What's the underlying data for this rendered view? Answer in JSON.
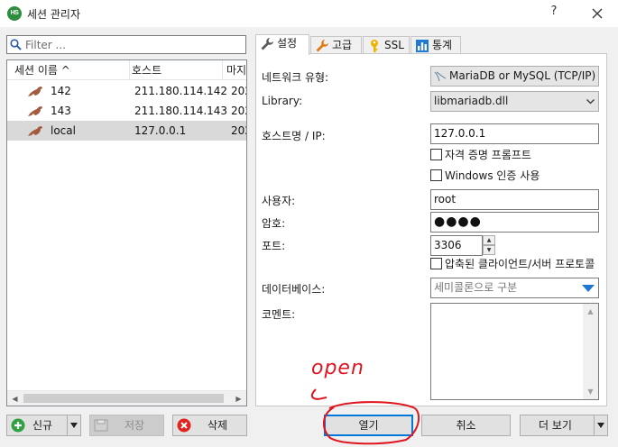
{
  "window": {
    "title": "세션 관리자",
    "icon_text": "HS",
    "help_label": "?",
    "close_label": "X"
  },
  "filter": {
    "placeholder": "Filter ..."
  },
  "session_list": {
    "columns": [
      "세션 이름 ^",
      "호스트",
      "마지"
    ],
    "rows": [
      {
        "name": "142",
        "host": "211.180.114.142",
        "extra": "202",
        "selected": false
      },
      {
        "name": "143",
        "host": "211.180.114.143",
        "extra": "202",
        "selected": false
      },
      {
        "name": "local",
        "host": "127.0.0.1",
        "extra": "202",
        "selected": true
      }
    ]
  },
  "tabs": [
    {
      "label": "설정",
      "icon": "wrench-icon",
      "active": true
    },
    {
      "label": "고급",
      "icon": "wrench-orange-icon",
      "active": false
    },
    {
      "label": "SSL",
      "icon": "key-icon",
      "active": false
    },
    {
      "label": "통계",
      "icon": "bar-chart-icon",
      "active": false
    }
  ],
  "settings": {
    "network_type_label": "네트워크 유형:",
    "network_type_value": "MariaDB or MySQL (TCP/IP)",
    "library_label": "Library:",
    "library_value": "libmariadb.dll",
    "host_label": "호스트명 / IP:",
    "host_value": "127.0.0.1",
    "prompt_credentials_label": "자격 증명 프롬프트",
    "windows_auth_label": "Windows 인증 사용",
    "user_label": "사용자:",
    "user_value": "root",
    "password_label": "암호:",
    "password_value": "●●●●",
    "port_label": "포트:",
    "port_value": "3306",
    "compressed_label": "압축된 클라이언트/서버 프로토콜",
    "databases_label": "데이터베이스:",
    "databases_placeholder": "세미콜론으로 구분",
    "comment_label": "코멘트:"
  },
  "buttons": {
    "new": "신규",
    "save": "저장",
    "delete": "삭제",
    "open": "열기",
    "cancel": "취소",
    "more": "더 보기"
  },
  "annotation": {
    "text": "open"
  },
  "colors": {
    "accent": "#0078d7",
    "selection": "#d9d9d9",
    "annotation": "#e0141e",
    "dropdown_arrow": "#1e78d2"
  }
}
